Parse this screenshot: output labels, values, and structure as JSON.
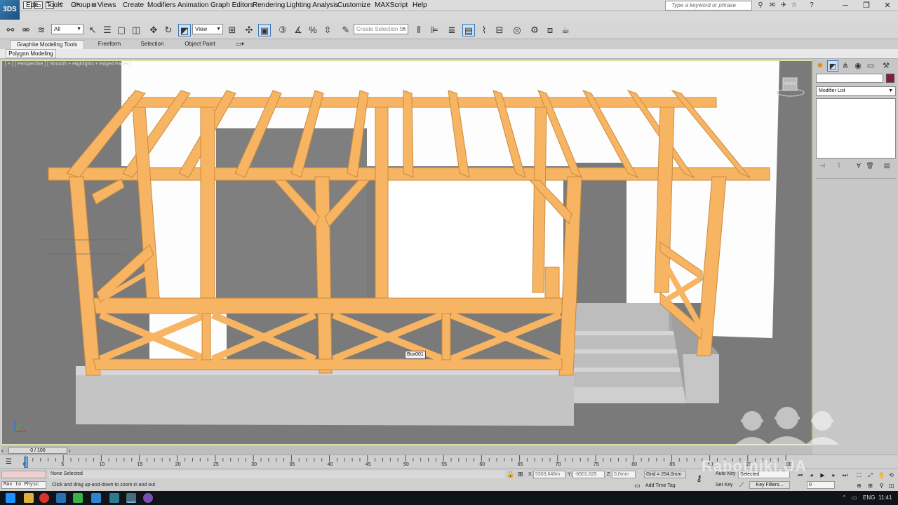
{
  "app": {
    "logo_text": "3DS",
    "search_placeholder": "Type a keyword or phrase"
  },
  "menu": [
    "Edit",
    "Tools",
    "Group",
    "Views",
    "Create",
    "Modifiers",
    "Animation",
    "Graph Editors",
    "Rendering",
    "Lighting Analysis",
    "Customize",
    "MAXScript",
    "Help"
  ],
  "toolbar": {
    "filter_value": "All",
    "refcoord_value": "View",
    "selection_set_placeholder": "Create Selection Se"
  },
  "ribbon": {
    "tabs": [
      "Graphite Modeling Tools",
      "Freeform",
      "Selection",
      "Object Paint"
    ],
    "active_panel": "Polygon Modeling"
  },
  "viewport": {
    "label": "[ + ] [ Perspective ] [ Smooth + Highlights + Edged Faces ]",
    "viewcube_label": "FRONT",
    "object_tag": "Box001"
  },
  "command_panel": {
    "modifier_list_label": "Modifier List",
    "object_color": "#8b1b3c"
  },
  "timeline": {
    "frame_display": "0 / 100",
    "ticks": [
      "0",
      "5",
      "10",
      "15",
      "20",
      "25",
      "30",
      "35",
      "40",
      "45",
      "50",
      "55",
      "60",
      "65",
      "70",
      "75",
      "80",
      "85",
      "90",
      "95",
      "100"
    ]
  },
  "status": {
    "maxscript_listener": "Max to Physc",
    "selection_status": "None Selected",
    "prompt": "Click and drag up-and-down to zoom in and out",
    "x_label": "X:",
    "x_value": "5303,648m",
    "y_label": "Y:",
    "y_value": "-6901,025",
    "z_label": "Z:",
    "z_value": "0,0mm",
    "grid": "Grid = 254,0mm",
    "add_time_tag": "Add Time Tag",
    "auto_key": "Auto Key",
    "auto_key_mode": "Selected",
    "set_key": "Set Key",
    "key_filters": "Key Filters...",
    "current_frame": "0"
  },
  "taskbar": {
    "language": "ENG",
    "time": "11:41"
  },
  "watermark": {
    "text": "Rabotniki.UA"
  }
}
